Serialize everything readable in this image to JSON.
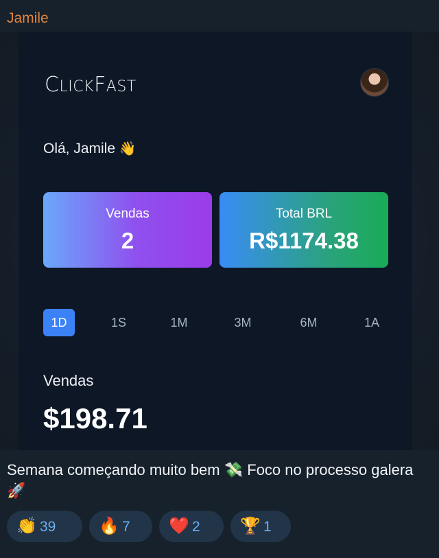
{
  "sender": {
    "name": "Jamile"
  },
  "app": {
    "logo_big_c": "C",
    "logo_lick": "LICK",
    "logo_big_f": "F",
    "logo_ast": "AST",
    "greeting": "Olá, Jamile",
    "greeting_emoji": "👋",
    "cards": [
      {
        "label": "Vendas",
        "value": "2"
      },
      {
        "label": "Total BRL",
        "value": "R$1174.38"
      }
    ],
    "periods": [
      "1D",
      "1S",
      "1M",
      "3M",
      "6M",
      "1A"
    ],
    "active_period": "1D",
    "sales_label": "Vendas",
    "sales_value": "$198.71"
  },
  "message": {
    "text_1": "Semana começando muito bem ",
    "emoji_1": "💸",
    "text_2": " Foco no processo galera ",
    "emoji_2": "🚀"
  },
  "reactions": [
    {
      "emoji": "👏",
      "count": "39"
    },
    {
      "emoji": "🔥",
      "count": "7"
    },
    {
      "emoji": "❤️",
      "count": "2"
    },
    {
      "emoji": "🏆",
      "count": "1"
    }
  ],
  "colors": {
    "sender": "#e0843d",
    "accent": "#3b82f6",
    "reaction_count": "#6ab2f2",
    "background": "#17212b"
  }
}
